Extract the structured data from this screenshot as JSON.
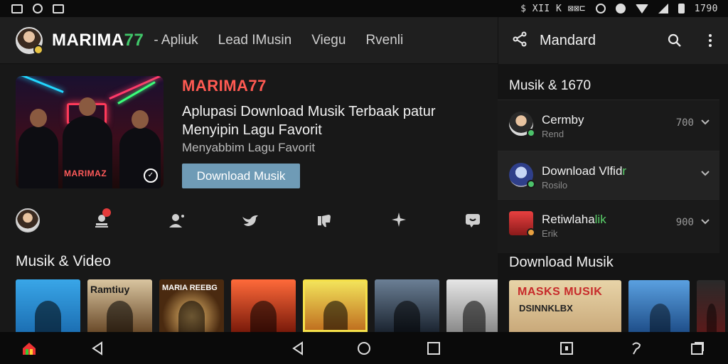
{
  "status_bar": {
    "left_icons": [
      "image-icon",
      "circle-icon",
      "gallery-icon"
    ],
    "right_text": "$ XII K ⊠⊠⊏",
    "time": "1790"
  },
  "app_bar": {
    "brand_main": "MARIMA",
    "brand_accent": "77",
    "nav": [
      "- Apliuk",
      "Lead IMusin",
      "Viegu",
      "Rvenli"
    ]
  },
  "hero": {
    "image_caption": "MARIMAZ",
    "kicker": "MARIMA77",
    "title": "Aplupasi Download Musik Terbaak patur Menyipin Lagu Favorit",
    "subtitle": "Menyabbim Lagu Favorit",
    "button": "Download Musik"
  },
  "icon_row": [
    "avatar",
    "notification-icon",
    "user-icon",
    "bird-icon",
    "thumbs-down-icon",
    "sparkle-icon",
    "chat-icon"
  ],
  "section_title": "Musik & Video",
  "thumbnails": [
    {
      "label": "",
      "color": "#39a6e8"
    },
    {
      "label": "Ramtiuy",
      "color": "#d9c5a0"
    },
    {
      "label": "MARIA REEBG",
      "color": "#f0c070"
    },
    {
      "label": "",
      "color": "#ff6a3a"
    },
    {
      "label": "",
      "color": "#f2e25a"
    },
    {
      "label": "",
      "color": "#6b7f95"
    },
    {
      "label": "",
      "color": "#e6e6e6"
    }
  ],
  "side_panel": {
    "title": "Mandard",
    "header": "Musik & 1670",
    "cards": [
      {
        "name": "Cermby",
        "sub": "Rend",
        "count": "700"
      },
      {
        "name": "Download Vlfid",
        "name_accent": "r",
        "sub": "Rosilo",
        "count": ""
      },
      {
        "name": "Retiwlaha",
        "name_accent": "lik",
        "sub": "Erik",
        "count": "900"
      }
    ],
    "section": "Download Musik",
    "thumb_title": "MASKS MUSIK",
    "thumb_sub": "DSINNKLBX"
  },
  "colors": {
    "accent_red": "#ff5a52",
    "accent_green": "#41c86a",
    "button_blue": "#6f9bb6",
    "background": "#181818"
  }
}
